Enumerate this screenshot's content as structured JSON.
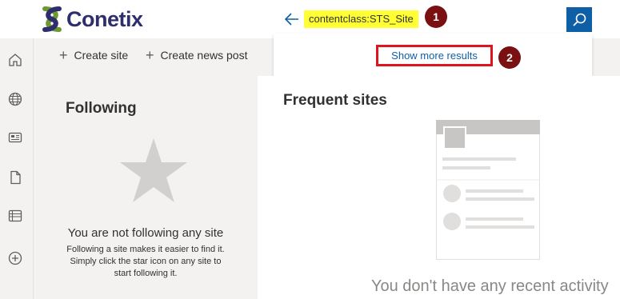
{
  "header": {
    "logo_text": "Conetix",
    "search": {
      "query": "contentclass:STS_Site",
      "back_icon": "arrow-left-icon",
      "search_icon": "search-icon"
    },
    "dropdown": {
      "show_more_label": "Show more results"
    }
  },
  "annotations": {
    "badge_1": "1",
    "badge_2": "2"
  },
  "leftrail": {
    "icons": [
      "home-icon",
      "globe-icon",
      "news-icon",
      "file-icon",
      "list-icon",
      "add-icon"
    ]
  },
  "commandbar": {
    "create_site": "Create site",
    "create_news_post": "Create news post",
    "plus": "+"
  },
  "following": {
    "title": "Following",
    "empty_title": "You are not following any site",
    "empty_desc": "Following a site makes it easier to find it. Simply click the star icon on any site to start following it."
  },
  "frequent": {
    "title": "Frequent sites",
    "empty_text": "You don't have any recent activity"
  },
  "colors": {
    "brand_blue": "#0f5fa6",
    "highlight": "#ffff33",
    "annotation_red": "#e0141e",
    "badge": "#7a1012"
  }
}
